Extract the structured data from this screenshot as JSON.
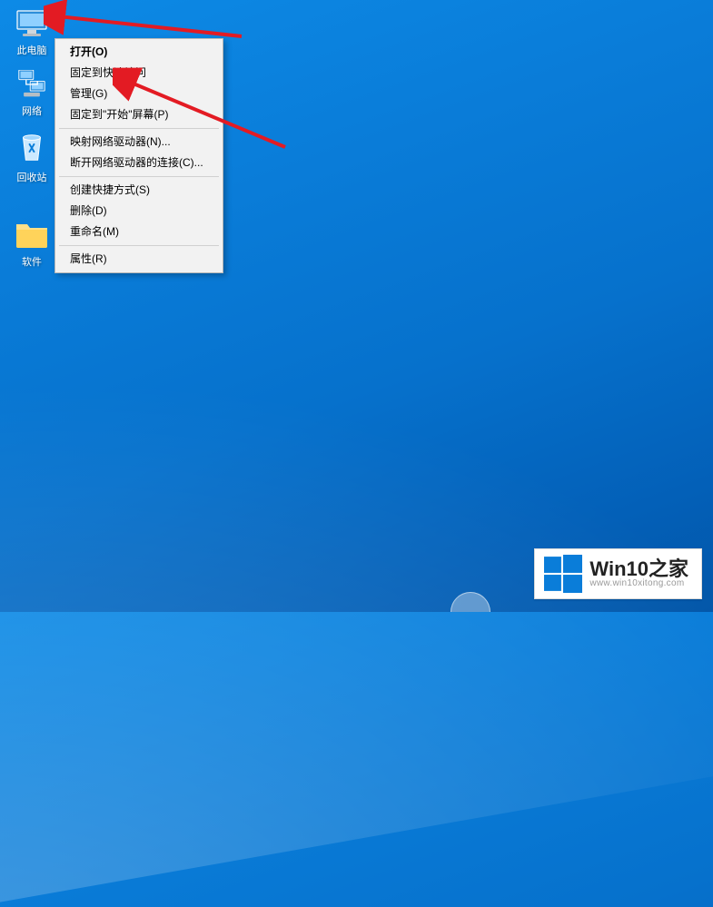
{
  "desktop": {
    "icons": [
      {
        "id": "this-pc",
        "label": "此电脑"
      },
      {
        "id": "network",
        "label": "网络"
      },
      {
        "id": "recycle-bin",
        "label": "回收站"
      },
      {
        "id": "software-folder",
        "label": "软件"
      }
    ]
  },
  "context_menu": {
    "groups": [
      [
        {
          "label": "打开(O)",
          "bold": true
        },
        {
          "label": "固定到快速访问"
        },
        {
          "label": "管理(G)"
        },
        {
          "label": "固定到\"开始\"屏幕(P)"
        }
      ],
      [
        {
          "label": "映射网络驱动器(N)..."
        },
        {
          "label": "断开网络驱动器的连接(C)..."
        }
      ],
      [
        {
          "label": "创建快捷方式(S)"
        },
        {
          "label": "删除(D)"
        },
        {
          "label": "重命名(M)"
        }
      ],
      [
        {
          "label": "属性(R)"
        }
      ]
    ]
  },
  "watermark": {
    "title_en": "Win10",
    "title_zh": "之家",
    "url": "www.win10xitong.com"
  },
  "colors": {
    "arrow": "#e31b23",
    "menu_bg": "#f2f2f2",
    "winlogo": "#0a7dd9"
  }
}
